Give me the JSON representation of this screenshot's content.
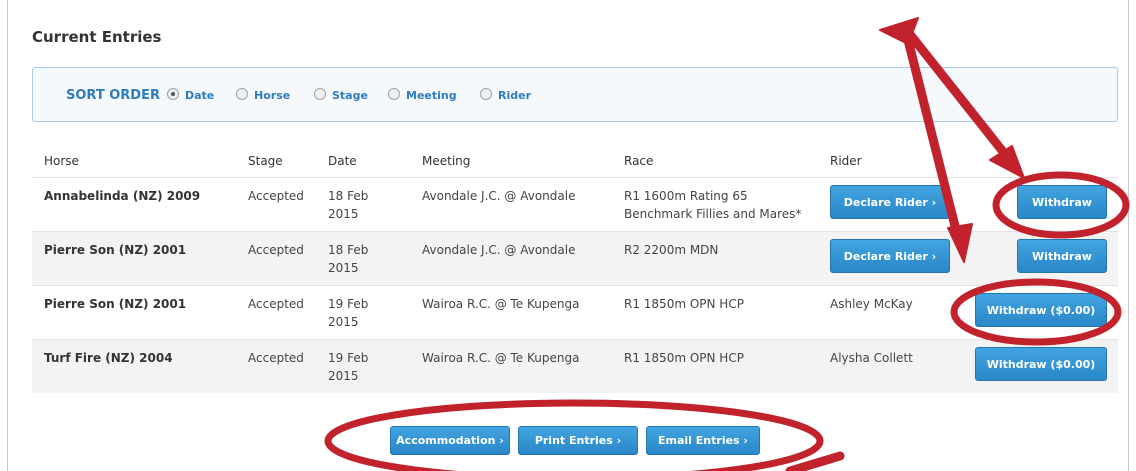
{
  "page": {
    "title": "Current Entries"
  },
  "sort": {
    "label": "SORT ORDER",
    "options": [
      {
        "label": "Date",
        "checked": true
      },
      {
        "label": "Horse",
        "checked": false
      },
      {
        "label": "Stage",
        "checked": false
      },
      {
        "label": "Meeting",
        "checked": false
      },
      {
        "label": "Rider",
        "checked": false
      }
    ]
  },
  "table": {
    "headers": [
      "Horse",
      "Stage",
      "Date",
      "Meeting",
      "Race",
      "Rider"
    ],
    "rows": [
      {
        "horse": "Annabelinda (NZ) 2009",
        "stage": "Accepted",
        "date_line1": "18 Feb",
        "date_line2": "2015",
        "meeting": "Avondale J.C. @ Avondale",
        "race_line1": "R1 1600m Rating 65",
        "race_line2": "Benchmark Fillies and Mares*",
        "rider": "",
        "rider_button": "Declare Rider ›",
        "action_button": "Withdraw"
      },
      {
        "horse": "Pierre Son (NZ) 2001",
        "stage": "Accepted",
        "date_line1": "18 Feb",
        "date_line2": "2015",
        "meeting": "Avondale J.C. @ Avondale",
        "race_line1": "R2 2200m MDN",
        "race_line2": "",
        "rider": "",
        "rider_button": "Declare Rider ›",
        "action_button": "Withdraw"
      },
      {
        "horse": "Pierre Son (NZ) 2001",
        "stage": "Accepted",
        "date_line1": "19 Feb",
        "date_line2": "2015",
        "meeting": "Wairoa R.C. @ Te Kupenga",
        "race_line1": "R1 1850m OPN HCP",
        "race_line2": "",
        "rider": "Ashley McKay",
        "rider_button": "",
        "action_button": "Withdraw ($0.00)"
      },
      {
        "horse": "Turf Fire (NZ) 2004",
        "stage": "Accepted",
        "date_line1": "19 Feb",
        "date_line2": "2015",
        "meeting": "Wairoa R.C. @ Te Kupenga",
        "race_line1": "R1 1850m OPN HCP",
        "race_line2": "",
        "rider": "Alysha Collett",
        "rider_button": "",
        "action_button": "Withdraw ($0.00)"
      }
    ]
  },
  "footer_buttons": {
    "accommodation": "Accommodation ›",
    "print": "Print Entries ›",
    "email": "Email Entries ›"
  },
  "colors": {
    "accent": "#2f7bbf",
    "button": "#2a87c8",
    "annotation": "#c1222b"
  }
}
